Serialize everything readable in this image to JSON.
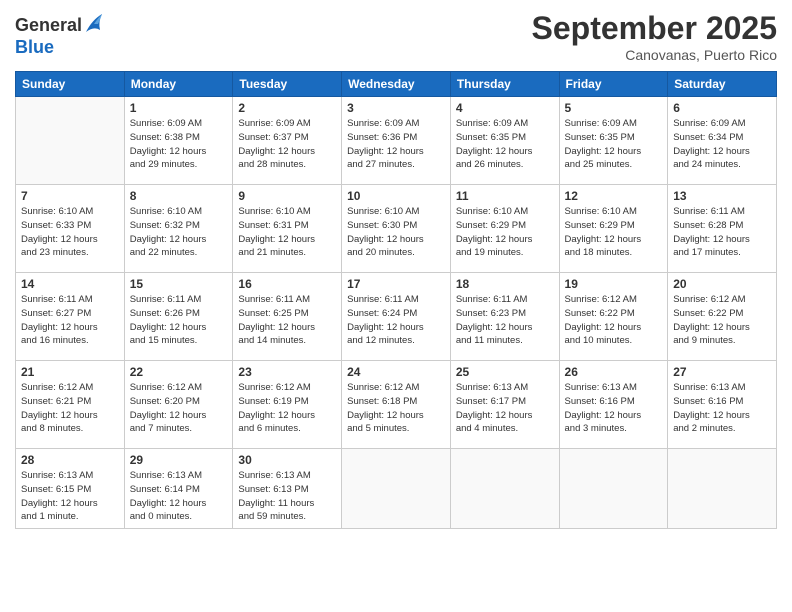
{
  "header": {
    "logo": {
      "general": "General",
      "blue": "Blue"
    },
    "title": "September 2025",
    "location": "Canovanas, Puerto Rico"
  },
  "days_of_week": [
    "Sunday",
    "Monday",
    "Tuesday",
    "Wednesday",
    "Thursday",
    "Friday",
    "Saturday"
  ],
  "weeks": [
    [
      {
        "day": "",
        "info": ""
      },
      {
        "day": "1",
        "info": "Sunrise: 6:09 AM\nSunset: 6:38 PM\nDaylight: 12 hours\nand 29 minutes."
      },
      {
        "day": "2",
        "info": "Sunrise: 6:09 AM\nSunset: 6:37 PM\nDaylight: 12 hours\nand 28 minutes."
      },
      {
        "day": "3",
        "info": "Sunrise: 6:09 AM\nSunset: 6:36 PM\nDaylight: 12 hours\nand 27 minutes."
      },
      {
        "day": "4",
        "info": "Sunrise: 6:09 AM\nSunset: 6:35 PM\nDaylight: 12 hours\nand 26 minutes."
      },
      {
        "day": "5",
        "info": "Sunrise: 6:09 AM\nSunset: 6:35 PM\nDaylight: 12 hours\nand 25 minutes."
      },
      {
        "day": "6",
        "info": "Sunrise: 6:09 AM\nSunset: 6:34 PM\nDaylight: 12 hours\nand 24 minutes."
      }
    ],
    [
      {
        "day": "7",
        "info": "Sunrise: 6:10 AM\nSunset: 6:33 PM\nDaylight: 12 hours\nand 23 minutes."
      },
      {
        "day": "8",
        "info": "Sunrise: 6:10 AM\nSunset: 6:32 PM\nDaylight: 12 hours\nand 22 minutes."
      },
      {
        "day": "9",
        "info": "Sunrise: 6:10 AM\nSunset: 6:31 PM\nDaylight: 12 hours\nand 21 minutes."
      },
      {
        "day": "10",
        "info": "Sunrise: 6:10 AM\nSunset: 6:30 PM\nDaylight: 12 hours\nand 20 minutes."
      },
      {
        "day": "11",
        "info": "Sunrise: 6:10 AM\nSunset: 6:29 PM\nDaylight: 12 hours\nand 19 minutes."
      },
      {
        "day": "12",
        "info": "Sunrise: 6:10 AM\nSunset: 6:29 PM\nDaylight: 12 hours\nand 18 minutes."
      },
      {
        "day": "13",
        "info": "Sunrise: 6:11 AM\nSunset: 6:28 PM\nDaylight: 12 hours\nand 17 minutes."
      }
    ],
    [
      {
        "day": "14",
        "info": "Sunrise: 6:11 AM\nSunset: 6:27 PM\nDaylight: 12 hours\nand 16 minutes."
      },
      {
        "day": "15",
        "info": "Sunrise: 6:11 AM\nSunset: 6:26 PM\nDaylight: 12 hours\nand 15 minutes."
      },
      {
        "day": "16",
        "info": "Sunrise: 6:11 AM\nSunset: 6:25 PM\nDaylight: 12 hours\nand 14 minutes."
      },
      {
        "day": "17",
        "info": "Sunrise: 6:11 AM\nSunset: 6:24 PM\nDaylight: 12 hours\nand 12 minutes."
      },
      {
        "day": "18",
        "info": "Sunrise: 6:11 AM\nSunset: 6:23 PM\nDaylight: 12 hours\nand 11 minutes."
      },
      {
        "day": "19",
        "info": "Sunrise: 6:12 AM\nSunset: 6:22 PM\nDaylight: 12 hours\nand 10 minutes."
      },
      {
        "day": "20",
        "info": "Sunrise: 6:12 AM\nSunset: 6:22 PM\nDaylight: 12 hours\nand 9 minutes."
      }
    ],
    [
      {
        "day": "21",
        "info": "Sunrise: 6:12 AM\nSunset: 6:21 PM\nDaylight: 12 hours\nand 8 minutes."
      },
      {
        "day": "22",
        "info": "Sunrise: 6:12 AM\nSunset: 6:20 PM\nDaylight: 12 hours\nand 7 minutes."
      },
      {
        "day": "23",
        "info": "Sunrise: 6:12 AM\nSunset: 6:19 PM\nDaylight: 12 hours\nand 6 minutes."
      },
      {
        "day": "24",
        "info": "Sunrise: 6:12 AM\nSunset: 6:18 PM\nDaylight: 12 hours\nand 5 minutes."
      },
      {
        "day": "25",
        "info": "Sunrise: 6:13 AM\nSunset: 6:17 PM\nDaylight: 12 hours\nand 4 minutes."
      },
      {
        "day": "26",
        "info": "Sunrise: 6:13 AM\nSunset: 6:16 PM\nDaylight: 12 hours\nand 3 minutes."
      },
      {
        "day": "27",
        "info": "Sunrise: 6:13 AM\nSunset: 6:16 PM\nDaylight: 12 hours\nand 2 minutes."
      }
    ],
    [
      {
        "day": "28",
        "info": "Sunrise: 6:13 AM\nSunset: 6:15 PM\nDaylight: 12 hours\nand 1 minute."
      },
      {
        "day": "29",
        "info": "Sunrise: 6:13 AM\nSunset: 6:14 PM\nDaylight: 12 hours\nand 0 minutes."
      },
      {
        "day": "30",
        "info": "Sunrise: 6:13 AM\nSunset: 6:13 PM\nDaylight: 11 hours\nand 59 minutes."
      },
      {
        "day": "",
        "info": ""
      },
      {
        "day": "",
        "info": ""
      },
      {
        "day": "",
        "info": ""
      },
      {
        "day": "",
        "info": ""
      }
    ]
  ]
}
